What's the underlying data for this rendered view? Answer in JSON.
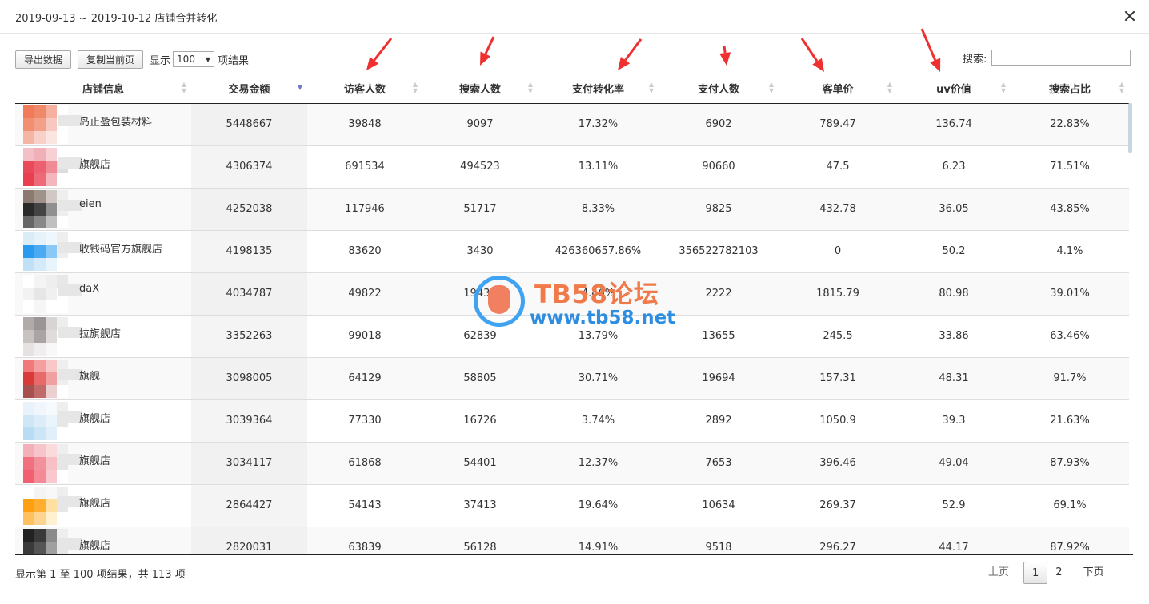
{
  "dialog": {
    "title": "2019-09-13 ~ 2019-10-12 店铺合并转化"
  },
  "toolbar": {
    "export_label": "导出数据",
    "copy_label": "复制当前页",
    "show_label": "显示",
    "page_size": "100",
    "results_label": "项结果",
    "search_label": "搜索:",
    "search_value": ""
  },
  "table": {
    "columns": [
      "店铺信息",
      "交易金额",
      "访客人数",
      "搜索人数",
      "支付转化率",
      "支付人数",
      "客单价",
      "uv价值",
      "搜索占比"
    ],
    "sorted_column": "交易金额",
    "rows": [
      {
        "name": "岛止盈包装材料",
        "amount": "5448667",
        "visitors": "39848",
        "search": "9097",
        "cvr": "17.32%",
        "payers": "6902",
        "aov": "789.47",
        "uv": "136.74",
        "search_ratio": "22.83%"
      },
      {
        "name": "旗舰店",
        "amount": "4306374",
        "visitors": "691534",
        "search": "494523",
        "cvr": "13.11%",
        "payers": "90660",
        "aov": "47.5",
        "uv": "6.23",
        "search_ratio": "71.51%"
      },
      {
        "name": "eien",
        "amount": "4252038",
        "visitors": "117946",
        "search": "51717",
        "cvr": "8.33%",
        "payers": "9825",
        "aov": "432.78",
        "uv": "36.05",
        "search_ratio": "43.85%"
      },
      {
        "name": "收钱码官方旗舰店",
        "amount": "4198135",
        "visitors": "83620",
        "search": "3430",
        "cvr": "426360657.86%",
        "payers": "356522782103",
        "aov": "0",
        "uv": "50.2",
        "search_ratio": "4.1%"
      },
      {
        "name": "daX",
        "amount": "4034787",
        "visitors": "49822",
        "search": "19437",
        "cvr": "4.46%",
        "payers": "2222",
        "aov": "1815.79",
        "uv": "80.98",
        "search_ratio": "39.01%"
      },
      {
        "name": "拉旗舰店",
        "amount": "3352263",
        "visitors": "99018",
        "search": "62839",
        "cvr": "13.79%",
        "payers": "13655",
        "aov": "245.5",
        "uv": "33.86",
        "search_ratio": "63.46%"
      },
      {
        "name": "旗舰",
        "amount": "3098005",
        "visitors": "64129",
        "search": "58805",
        "cvr": "30.71%",
        "payers": "19694",
        "aov": "157.31",
        "uv": "48.31",
        "search_ratio": "91.7%"
      },
      {
        "name": "旗舰店",
        "amount": "3039364",
        "visitors": "77330",
        "search": "16726",
        "cvr": "3.74%",
        "payers": "2892",
        "aov": "1050.9",
        "uv": "39.3",
        "search_ratio": "21.63%"
      },
      {
        "name": "旗舰店",
        "amount": "3034117",
        "visitors": "61868",
        "search": "54401",
        "cvr": "12.37%",
        "payers": "7653",
        "aov": "396.46",
        "uv": "49.04",
        "search_ratio": "87.93%"
      },
      {
        "name": "旗舰店",
        "amount": "2864427",
        "visitors": "54143",
        "search": "37413",
        "cvr": "19.64%",
        "payers": "10634",
        "aov": "269.37",
        "uv": "52.9",
        "search_ratio": "69.1%"
      },
      {
        "name": "旗舰店",
        "amount": "2820031",
        "visitors": "63839",
        "search": "56128",
        "cvr": "14.91%",
        "payers": "9518",
        "aov": "296.27",
        "uv": "44.17",
        "search_ratio": "87.92%"
      }
    ],
    "avatar_palettes": [
      [
        "#f07a5a",
        "#ee8a6a",
        "#f5b0a0",
        "#ffffff",
        "#f09070",
        "#f4a088",
        "#f7c8c0",
        "#ffffff",
        "#f5b5a5",
        "#f8d0c8",
        "#fbe5e0",
        "#ffffff"
      ],
      [
        "#f4c0c8",
        "#f0b0b8",
        "#f6d0d5",
        "#ffffff",
        "#e84a5a",
        "#ec6070",
        "#f08a95",
        "#dddddd",
        "#e8404f",
        "#ee6a78",
        "#f5b5bd",
        "#ffffff"
      ],
      [
        "#8a7a70",
        "#a0948a",
        "#d0c8c4",
        "#eeeeee",
        "#2a2a2a",
        "#444444",
        "#909090",
        "#eeeeee",
        "#666666",
        "#888888",
        "#c0c0c0",
        "#ffffff"
      ],
      [
        "#dcecf6",
        "#e6f2fa",
        "#f0f7fc",
        "#eeeeee",
        "#2a9af0",
        "#4aaaf2",
        "#8ac8f5",
        "#eeeeee",
        "#c0e0f8",
        "#d4eafa",
        "#e8f4fc",
        "#ffffff"
      ],
      [
        "#ffffff",
        "#f4f4f4",
        "#eeeeee",
        "#e8e8e8",
        "#f2f2f2",
        "#e6e6e6",
        "#f0f0f0",
        "#ffffff",
        "#ffffff",
        "#f6f6f6",
        "#ffffff",
        "#ffffff"
      ],
      [
        "#b0aaa8",
        "#9a9494",
        "#d8d4d4",
        "#eeeeee",
        "#c8c2c0",
        "#aaa4a4",
        "#e0dcdc",
        "#ffffff",
        "#e6e2e2",
        "#f0eeee",
        "#f8f8f8",
        "#ffffff"
      ],
      [
        "#f07a7a",
        "#f4a0a0",
        "#f8c8c8",
        "#eeeeee",
        "#d83a3a",
        "#e86a6a",
        "#f0a0a0",
        "#eeeeee",
        "#a85050",
        "#c06a6a",
        "#ecd0d0",
        "#ffffff"
      ],
      [
        "#e8f2fa",
        "#f0f6fc",
        "#f6fafd",
        "#eeeeee",
        "#cfe6f6",
        "#dcecf8",
        "#eaf4fb",
        "#e6e6e6",
        "#b8dcf4",
        "#cce6f7",
        "#e0eff9",
        "#ffffff"
      ],
      [
        "#f4b0b8",
        "#f6c4ca",
        "#fadadd",
        "#eeeeee",
        "#f07080",
        "#f2909c",
        "#f7c0c7",
        "#e6e6e6",
        "#f06070",
        "#f48a96",
        "#f9c8ce",
        "#ffffff"
      ],
      [
        "#ffffff",
        "#f4f4f4",
        "#f8f8f8",
        "#eeeeee",
        "#ffa010",
        "#ffae30",
        "#ffe0a0",
        "#e6e6e6",
        "#ffc060",
        "#ffd490",
        "#fff0d0",
        "#ffffff"
      ],
      [
        "#222222",
        "#3a3a3a",
        "#8a8a8a",
        "#eeeeee",
        "#3a3a3a",
        "#555555",
        "#a0a0a0",
        "#e6e6e6",
        "#4a4a4a",
        "#666666",
        "#d0d0d0",
        "#ffffff"
      ]
    ]
  },
  "footer": {
    "info": "显示第 1 至 100 项结果，共 113 项",
    "prev_label": "上页",
    "pages": [
      "1",
      "2"
    ],
    "active_page": "1",
    "next_label": "下页"
  },
  "watermark": {
    "title": "TB58论坛",
    "url": "www.tb58.net"
  },
  "colors": {
    "arrow": "#f03030",
    "sort_active": "#7777cc",
    "scrollbar": "#c9d4e3"
  }
}
